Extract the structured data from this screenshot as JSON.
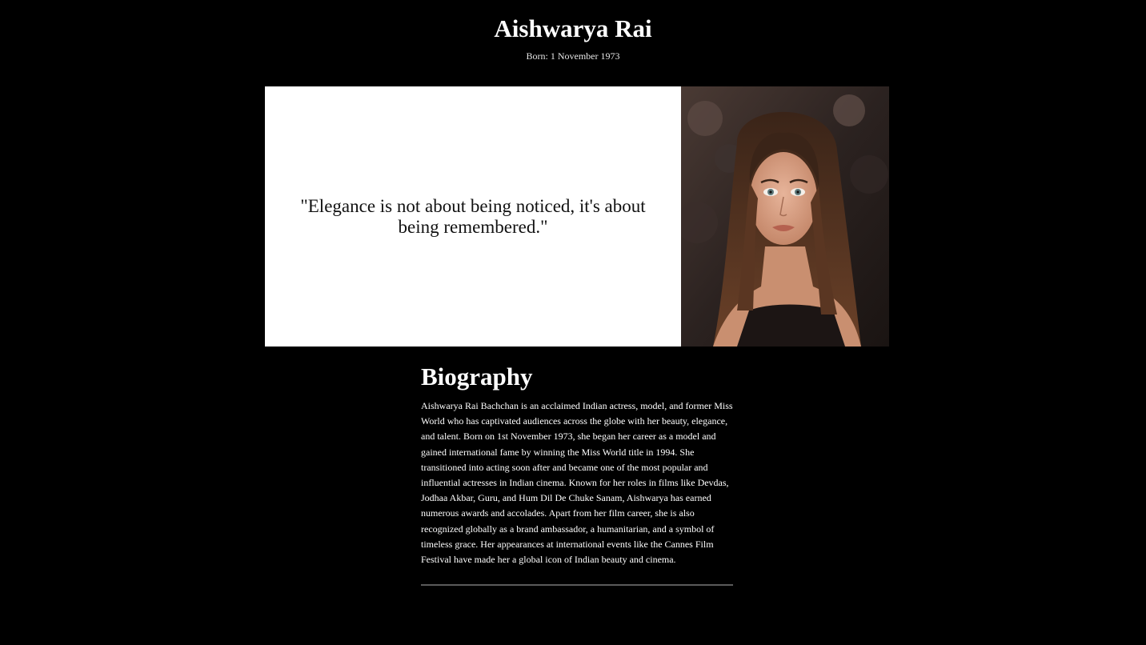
{
  "header": {
    "name": "Aishwarya Rai",
    "born": "Born: 1 November 1973"
  },
  "hero": {
    "quote": "\"Elegance is not about being noticed, it's about being remembered.\""
  },
  "biography": {
    "title": "Biography",
    "text": "Aishwarya Rai Bachchan is an acclaimed Indian actress, model, and former Miss World who has captivated audiences across the globe with her beauty, elegance, and talent. Born on 1st November 1973, she began her career as a model and gained international fame by winning the Miss World title in 1994. She transitioned into acting soon after and became one of the most popular and influential actresses in Indian cinema. Known for her roles in films like Devdas, Jodhaa Akbar, Guru, and Hum Dil De Chuke Sanam, Aishwarya has earned numerous awards and accolades. Apart from her film career, she is also recognized globally as a brand ambassador, a humanitarian, and a symbol of timeless grace. Her appearances at international events like the Cannes Film Festival have made her a global icon of Indian beauty and cinema."
  },
  "colors": {
    "background": "#000000",
    "quote_panel": "#ffffff",
    "divider": "#5a5a5a"
  }
}
